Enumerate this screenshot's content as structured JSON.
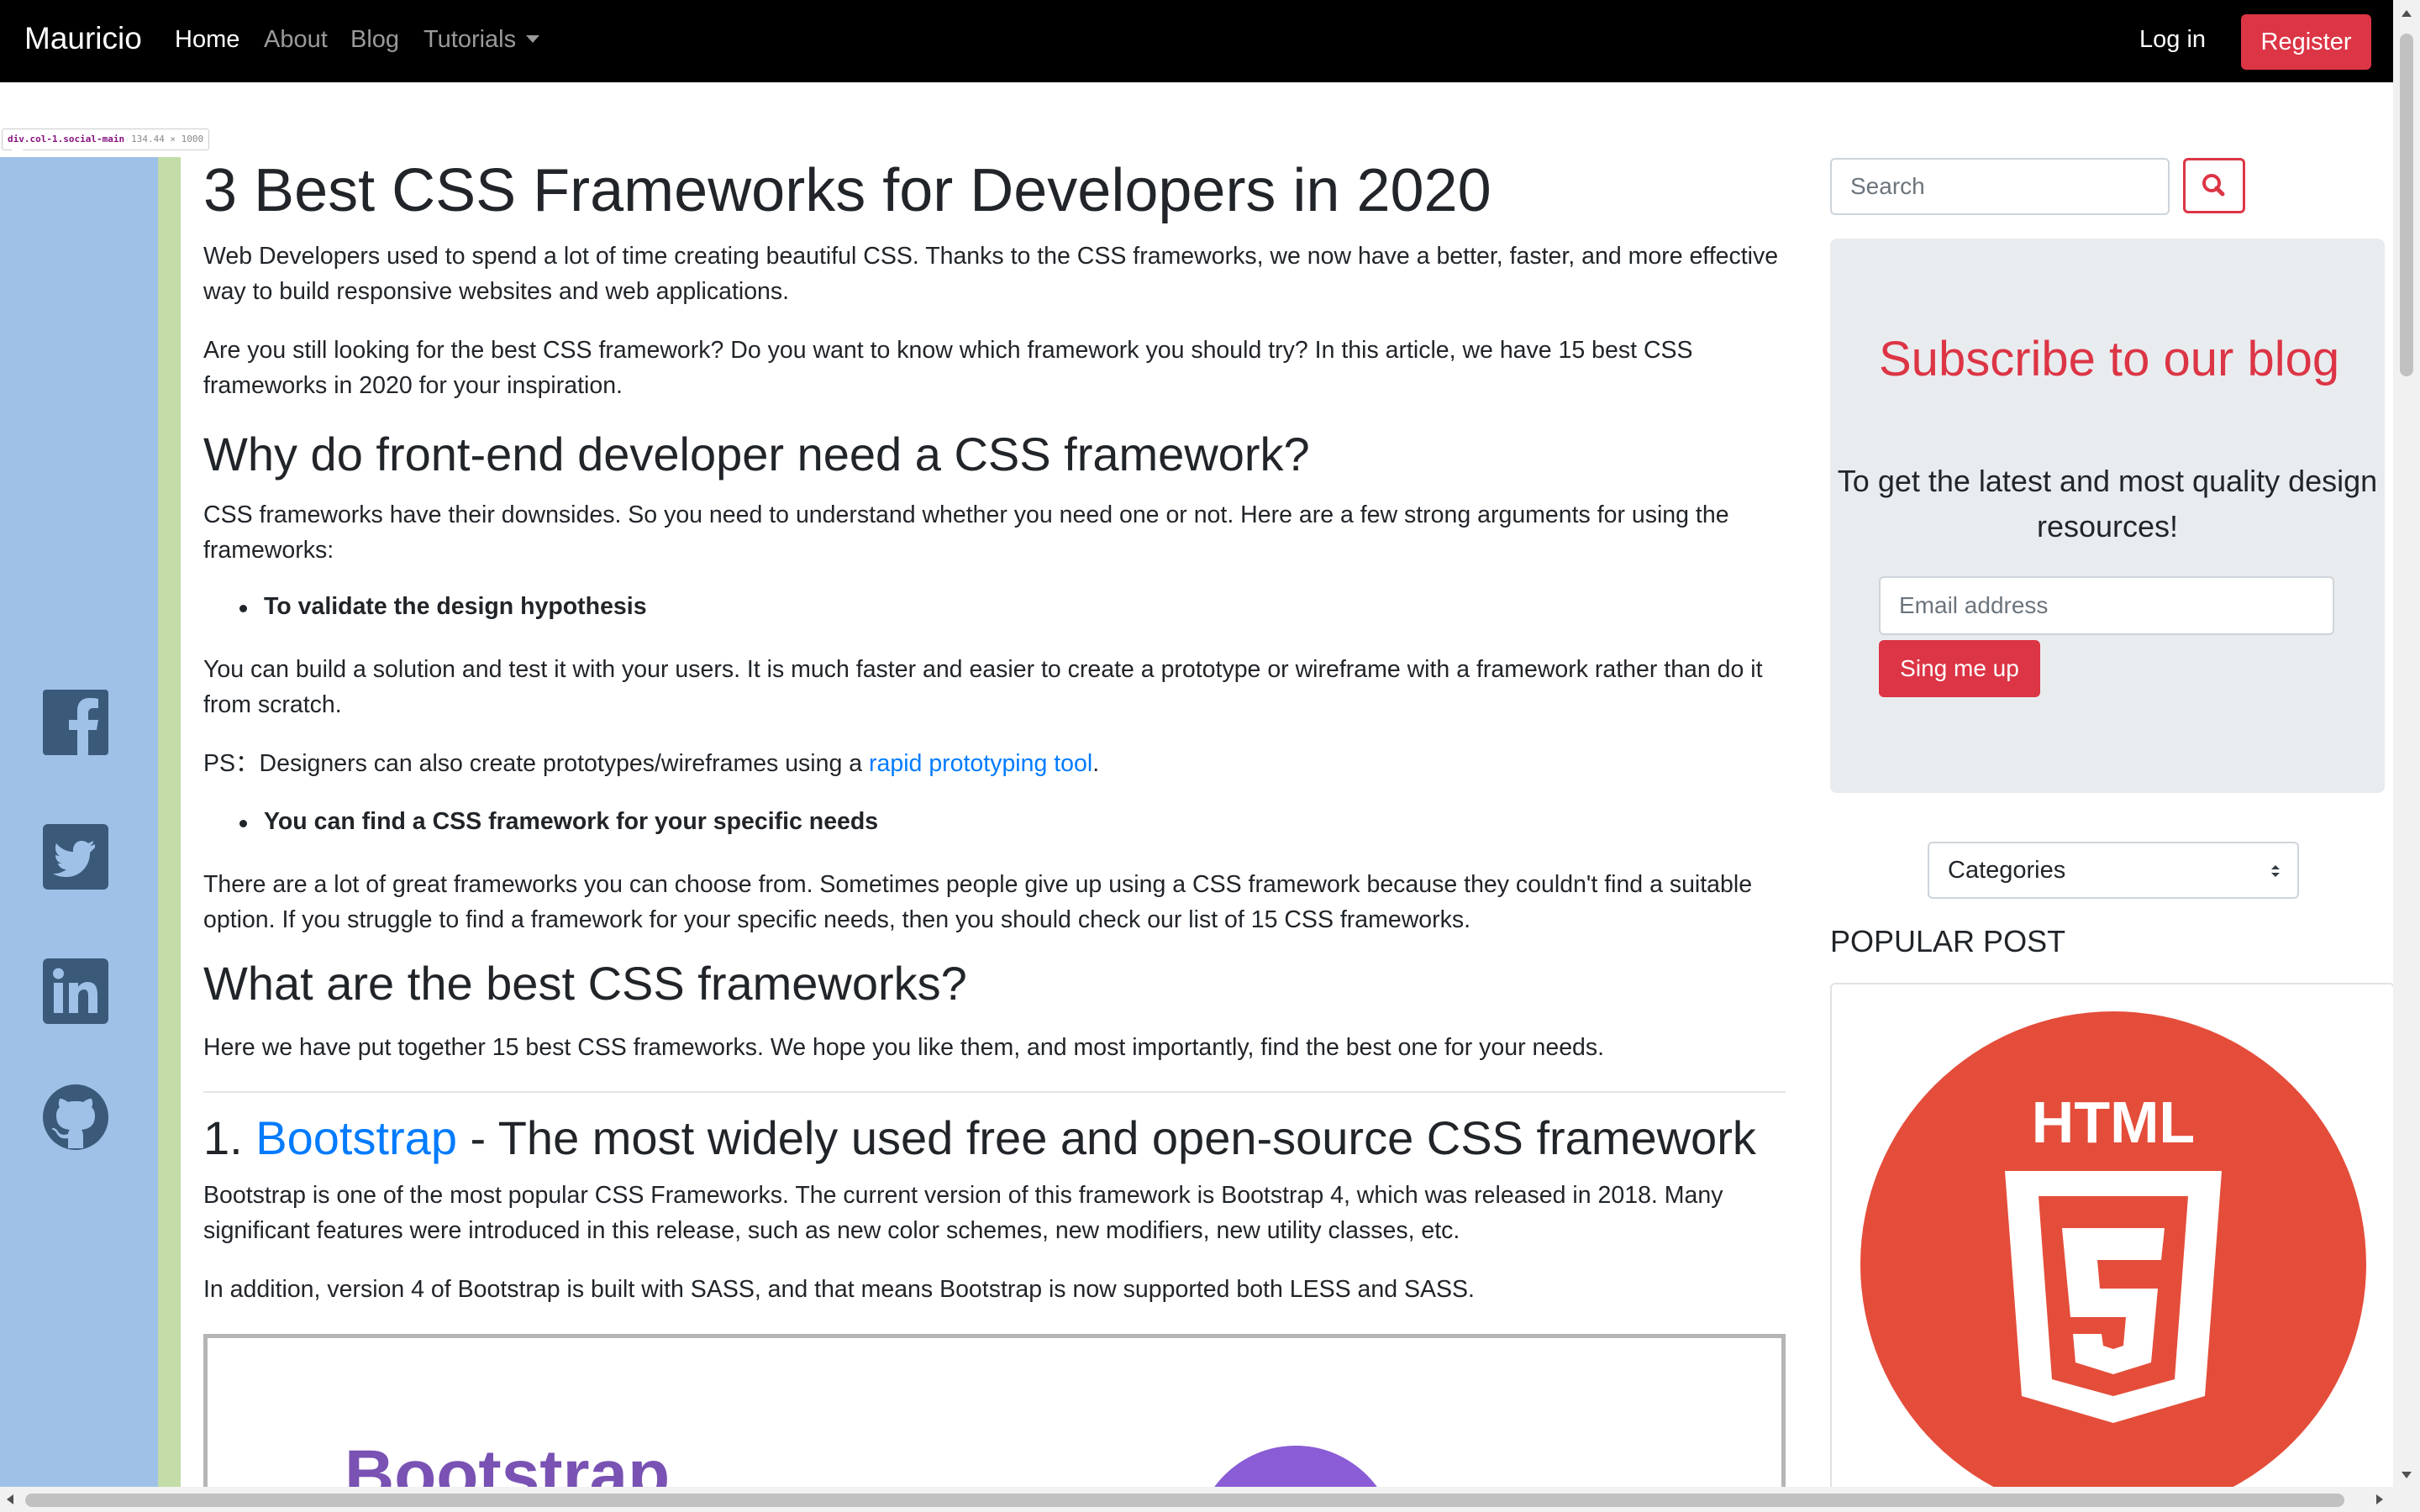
{
  "navbar": {
    "brand": "Mauricio",
    "links": [
      "Home",
      "About",
      "Blog",
      "Tutorials"
    ],
    "login": "Log in",
    "register": "Register"
  },
  "devtools": {
    "selector": "div.col-1.social-main",
    "dimensions": "134.44 × 1000"
  },
  "social": [
    "facebook-icon",
    "twitter-icon",
    "linkedin-icon",
    "github-icon"
  ],
  "colors": {
    "navbar": "#000000",
    "accent": "#dc3545",
    "link": "#007bff",
    "social_overlay": "#9fc1e8",
    "padding_overlay": "#c3dca8",
    "icon": "#3b5a7a"
  },
  "article": {
    "title": "3 Best CSS Frameworks for Developers in 2020",
    "p1": "Web Developers used to spend a lot of time creating beautiful CSS. Thanks to the CSS frameworks, we now have a better, faster, and more effective way to build responsive websites and web applications.",
    "p2": "Are you still looking for the best CSS framework? Do you want to know which framework you should try? In this article, we have 15 best CSS frameworks in 2020 for your inspiration.",
    "h2_why": "Why do front-end developer need a CSS framework?",
    "p3": "CSS frameworks have their downsides. So you need to understand whether you need one or not. Here are a few strong arguments for using the frameworks:",
    "bullet1": "To validate the design hypothesis",
    "p4": "You can build a solution and test it with your users. It is much faster and easier to create a prototype or wireframe with a framework rather than do it from scratch.",
    "ps_prefix": "PS：Designers can also create prototypes/wireframes using a ",
    "ps_link": "rapid prototyping tool",
    "ps_suffix": ".",
    "bullet2": "You can find a CSS framework for your specific needs",
    "p5": "There are a lot of great frameworks you can choose from. Sometimes people give up using a CSS framework because they couldn't find a suitable option. If you struggle to find a framework for your specific needs, then you should check our list of 15 CSS frameworks.",
    "h2_best": "What are the best CSS frameworks?",
    "p6": "Here we have put together 15 best CSS frameworks. We hope you like them, and most importantly, find the best one for your needs.",
    "h2_num": "1. ",
    "h2_link": "Bootstrap",
    "h2_rest": " - The most widely used free and open-source CSS framework",
    "p7": "Bootstrap is one of the most popular CSS Frameworks. The current version of this framework is Bootstrap 4, which was released in 2018. Many significant features were introduced in this release, such as new color schemes, new modifiers, new utility classes, etc.",
    "p8": "In addition, version 4 of Bootstrap is built with SASS, and that means Bootstrap is now supported both LESS and SASS.",
    "figure_text": "Bootstrap"
  },
  "sidebar": {
    "search_placeholder": "Search",
    "subscribe_title": "Subscribe to our blog",
    "subscribe_text": "To get the latest and most quality design resources!",
    "email_placeholder": "Email address",
    "subscribe_button": "Sing me up",
    "categories": "Categories",
    "popular_heading": "POPULAR POST",
    "popular_image_label": "HTML"
  }
}
